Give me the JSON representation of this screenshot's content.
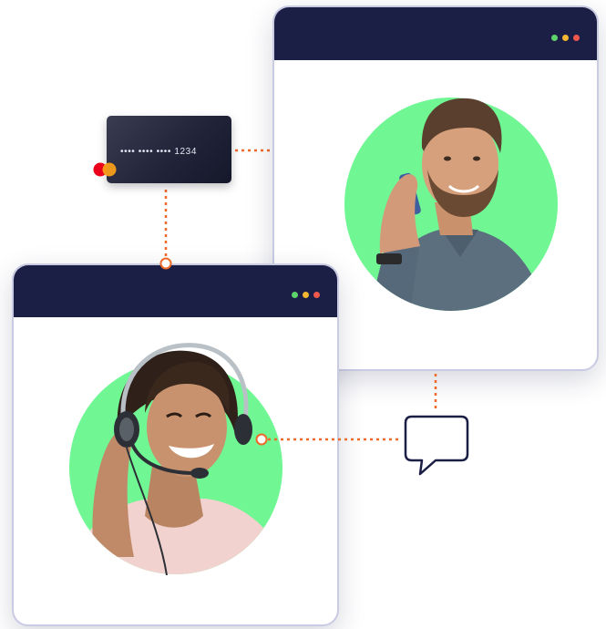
{
  "payment_card": {
    "masked_number": "•••• •••• •••• 1234",
    "brand_icon": "mastercard-logo-icon"
  },
  "customer_window": {
    "window_dots": [
      "#5fd36b",
      "#f5b731",
      "#f0574d"
    ],
    "avatar": "man-on-phone-photo"
  },
  "agent_window": {
    "window_dots": [
      "#5fd36b",
      "#f5b731",
      "#f0574d"
    ],
    "avatar": "support-agent-with-headset-photo"
  },
  "chat_icon": "speech-bubble-icon",
  "colors": {
    "titlebar": "#1c1f45",
    "avatar_circle": "#70f794",
    "connector": "#ee6a2a",
    "card": "#22243a"
  }
}
